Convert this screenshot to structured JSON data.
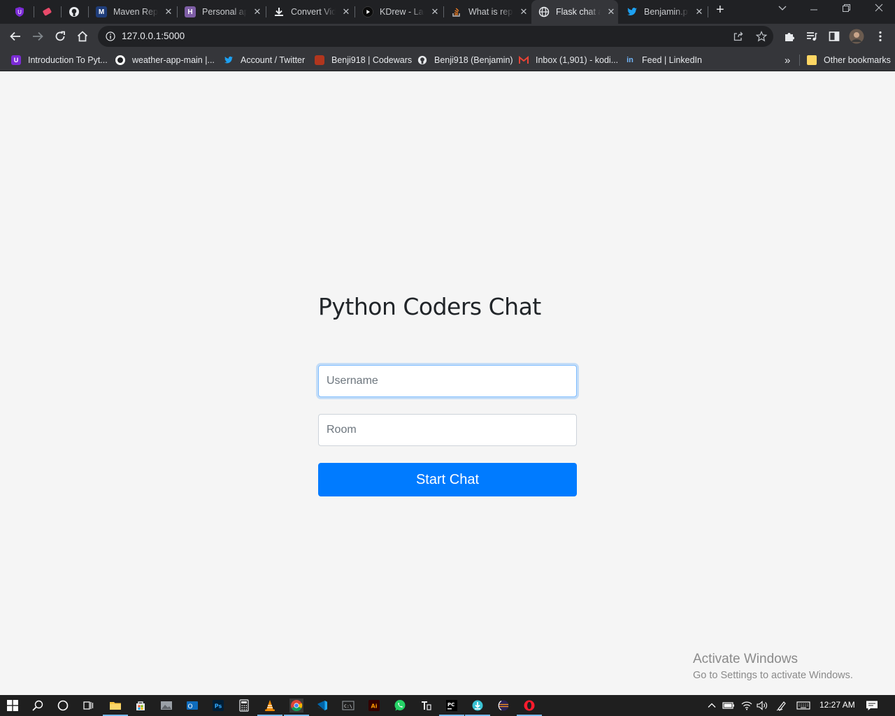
{
  "browser": {
    "tabs": [
      {
        "title": "",
        "icon": "ublock-icon",
        "color": "#7b2bd6",
        "pinned": true
      },
      {
        "title": "",
        "icon": "eraser-icon",
        "color": "#e84a6a",
        "pinned": true
      },
      {
        "title": "",
        "icon": "github-icon",
        "color": "#ffffff",
        "pinned": true
      },
      {
        "title": "Maven Repository",
        "icon": "maven-icon",
        "color": "#1f6feb"
      },
      {
        "title": "Personal app",
        "icon": "heroku-icon",
        "color": "#7e5ea6"
      },
      {
        "title": "Convert Video",
        "icon": "download-icon",
        "color": "#e8eaed"
      },
      {
        "title": "KDrew - Lagos",
        "icon": "play-icon",
        "color": "#111111"
      },
      {
        "title": "What is repl",
        "icon": "stackoverflow-icon",
        "color": "#f48024"
      },
      {
        "title": "Flask chat app",
        "icon": "globe-icon",
        "color": "#e8eaed",
        "active": true
      },
      {
        "title": "Benjamin.py",
        "icon": "twitter-icon",
        "color": "#1da1f2"
      }
    ],
    "new_tab_label": "+",
    "address": "127.0.0.1:5000",
    "bookmarks": [
      {
        "label": "Introduction To Pyt...",
        "icon": "ublock-icon",
        "color": "#7b2bd6"
      },
      {
        "label": "weather-app-main |...",
        "icon": "circle-icon",
        "color": "#ffffff"
      },
      {
        "label": "Account / Twitter",
        "icon": "twitter-icon",
        "color": "#1da1f2"
      },
      {
        "label": "Benji918 | Codewars",
        "icon": "codewars-icon",
        "color": "#b1361e"
      },
      {
        "label": "Benji918 (Benjamin)",
        "icon": "github-icon",
        "color": "#ffffff"
      },
      {
        "label": "Inbox (1,901) - kodi...",
        "icon": "gmail-icon",
        "color": "#ea4335"
      },
      {
        "label": "Feed | LinkedIn",
        "icon": "linkedin-icon",
        "color": "#0a66c2"
      }
    ],
    "more_bookmarks_label": "»",
    "other_bookmarks_label": "Other bookmarks"
  },
  "page": {
    "title": "Python Coders Chat",
    "username_placeholder": "Username",
    "room_placeholder": "Room",
    "start_button_label": "Start Chat",
    "accent_color": "#007bff"
  },
  "watermark": {
    "line1": "Activate Windows",
    "line2": "Go to Settings to activate Windows."
  },
  "taskbar": {
    "clock": "12:27 AM"
  }
}
